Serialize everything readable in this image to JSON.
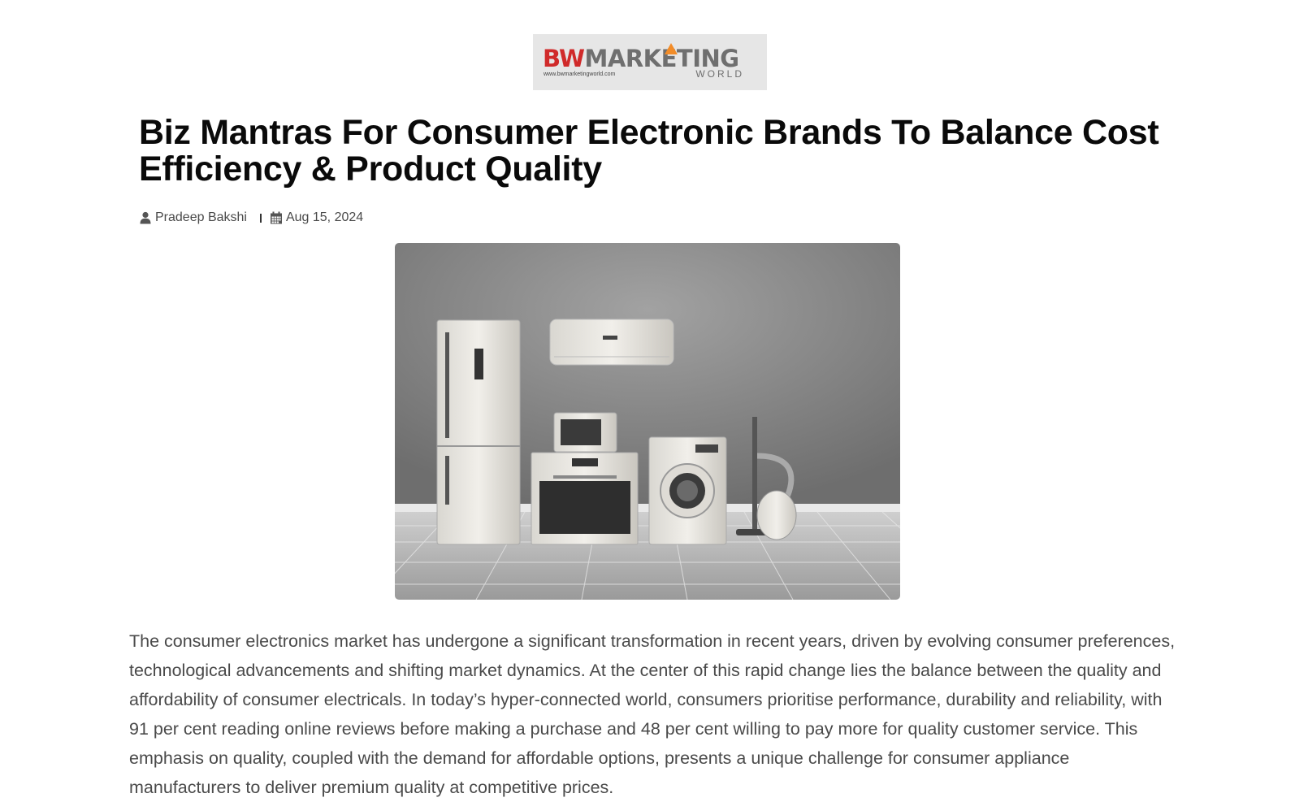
{
  "site": {
    "logo_bw": "BW",
    "logo_marketing": "MARKETING",
    "logo_sub": "WORLD",
    "logo_url": "www.bwmarketingworld.com"
  },
  "article": {
    "title": "Biz Mantras For Consumer Electronic Brands To Balance Cost Efficiency & Product Quality",
    "author": "Pradeep Bakshi",
    "date": "Aug 15, 2024",
    "body": "The consumer electronics market has undergone a significant transformation in recent years, driven by evolving consumer preferences, technological advancements and shifting market dynamics. At the center of this rapid change lies the balance between the quality and affordability of consumer electricals. In today’s hyper-connected world, consumers prioritise performance, durability and reliability, with 91 per cent reading online reviews before making a purchase and 48 per cent willing to pay more for quality customer service. This emphasis on quality, coupled with the demand for affordable options, presents a unique challenge for consumer appliance manufacturers to deliver premium quality at competitive prices."
  },
  "icons": {
    "author": "user-icon",
    "date": "calendar-icon"
  }
}
